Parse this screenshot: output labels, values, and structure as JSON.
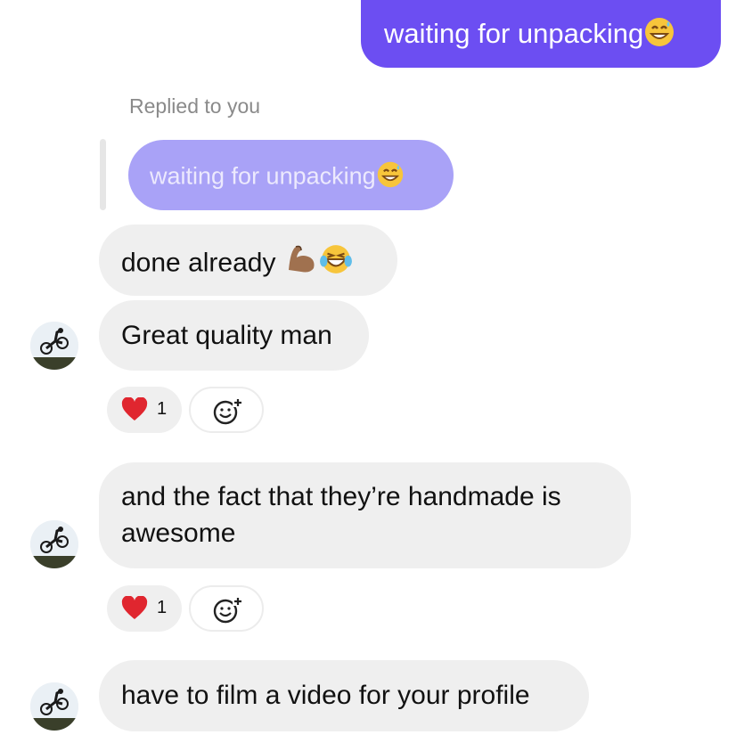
{
  "messages": {
    "outgoing_1": {
      "text": "waiting for unpacking",
      "emoji": "grinning-sweat-emoji"
    },
    "reply_label": "Replied to you",
    "quoted": {
      "text": "waiting for unpacking",
      "emoji": "grinning-sweat-emoji"
    },
    "incoming_1": {
      "text": "done already",
      "emojis": [
        "flexed-biceps-emoji",
        "tears-of-joy-emoji"
      ]
    },
    "incoming_2": {
      "text": "Great quality man",
      "reaction_count": "1"
    },
    "incoming_3": {
      "line1": "and the fact that they’re handmade is",
      "line2": "awesome",
      "reaction_count": "1"
    },
    "incoming_4": {
      "text": "have to film a video for your profile"
    }
  },
  "colors": {
    "outgoing_bubble": "#6c4ef2",
    "incoming_bubble": "#efefef",
    "quoted_bubble": "#a9a2f7",
    "heart": "#e0262f"
  },
  "icons": {
    "reaction": "red-heart-icon",
    "add_reaction": "add-reaction-smiley-icon",
    "avatar": "cyclist-avatar"
  }
}
